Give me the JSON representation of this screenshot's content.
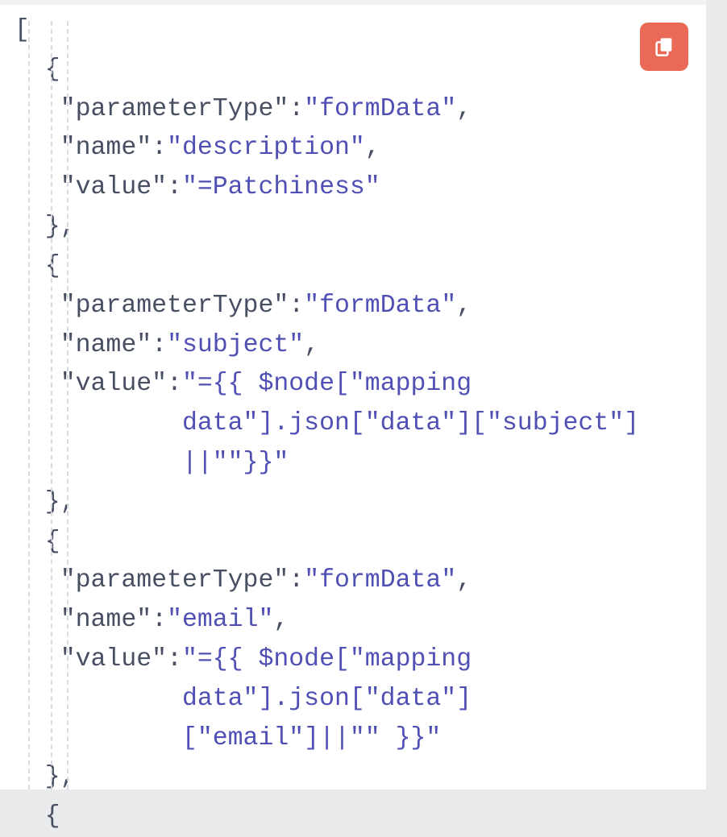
{
  "copy_button": {
    "label": "Copy",
    "icon_name": "copy-icon"
  },
  "code_tokens": [
    {
      "t": "[",
      "c": "pun"
    },
    {
      "t": "\n",
      "c": ""
    },
    {
      "t": "  {",
      "c": "pun"
    },
    {
      "t": "\n",
      "c": ""
    },
    {
      "t": "   ",
      "c": ""
    },
    {
      "t": "\"",
      "c": "pun"
    },
    {
      "t": "parameterType",
      "c": "k"
    },
    {
      "t": "\"",
      "c": "pun"
    },
    {
      "t": ":",
      "c": "pun"
    },
    {
      "t": "\"",
      "c": "vq"
    },
    {
      "t": "formData",
      "c": "v"
    },
    {
      "t": "\"",
      "c": "vq"
    },
    {
      "t": ",",
      "c": "pun"
    },
    {
      "t": "\n",
      "c": ""
    },
    {
      "t": "   ",
      "c": ""
    },
    {
      "t": "\"",
      "c": "pun"
    },
    {
      "t": "name",
      "c": "k"
    },
    {
      "t": "\"",
      "c": "pun"
    },
    {
      "t": ":",
      "c": "pun"
    },
    {
      "t": "\"",
      "c": "vq"
    },
    {
      "t": "description",
      "c": "v"
    },
    {
      "t": "\"",
      "c": "vq"
    },
    {
      "t": ",",
      "c": "pun"
    },
    {
      "t": "\n",
      "c": ""
    },
    {
      "t": "   ",
      "c": ""
    },
    {
      "t": "\"",
      "c": "pun"
    },
    {
      "t": "value",
      "c": "k"
    },
    {
      "t": "\"",
      "c": "pun"
    },
    {
      "t": ":",
      "c": "pun"
    },
    {
      "t": "\"",
      "c": "vq"
    },
    {
      "t": "=Patchiness",
      "c": "v"
    },
    {
      "t": "\"",
      "c": "vq"
    },
    {
      "t": "\n",
      "c": ""
    },
    {
      "t": "  },",
      "c": "pun"
    },
    {
      "t": "\n",
      "c": ""
    },
    {
      "t": "  {",
      "c": "pun"
    },
    {
      "t": "\n",
      "c": ""
    },
    {
      "t": "   ",
      "c": ""
    },
    {
      "t": "\"",
      "c": "pun"
    },
    {
      "t": "parameterType",
      "c": "k"
    },
    {
      "t": "\"",
      "c": "pun"
    },
    {
      "t": ":",
      "c": "pun"
    },
    {
      "t": "\"",
      "c": "vq"
    },
    {
      "t": "formData",
      "c": "v"
    },
    {
      "t": "\"",
      "c": "vq"
    },
    {
      "t": ",",
      "c": "pun"
    },
    {
      "t": "\n",
      "c": ""
    },
    {
      "t": "   ",
      "c": ""
    },
    {
      "t": "\"",
      "c": "pun"
    },
    {
      "t": "name",
      "c": "k"
    },
    {
      "t": "\"",
      "c": "pun"
    },
    {
      "t": ":",
      "c": "pun"
    },
    {
      "t": "\"",
      "c": "vq"
    },
    {
      "t": "subject",
      "c": "v"
    },
    {
      "t": "\"",
      "c": "vq"
    },
    {
      "t": ",",
      "c": "pun"
    },
    {
      "t": "\n",
      "c": ""
    },
    {
      "t": "   ",
      "c": ""
    },
    {
      "t": "\"",
      "c": "pun"
    },
    {
      "t": "value",
      "c": "k"
    },
    {
      "t": "\"",
      "c": "pun"
    },
    {
      "t": ":",
      "c": "pun"
    },
    {
      "t": "\"",
      "c": "vq"
    },
    {
      "t": "={{ $node[\"mapping ",
      "c": "v"
    },
    {
      "t": "\n",
      "c": ""
    },
    {
      "t": "           ",
      "c": ""
    },
    {
      "t": "data\"].json[\"data\"][\"subject\"]",
      "c": "v"
    },
    {
      "t": "\n",
      "c": ""
    },
    {
      "t": "           ",
      "c": ""
    },
    {
      "t": "||\"\"}}",
      "c": "v"
    },
    {
      "t": "\"",
      "c": "vq"
    },
    {
      "t": "\n",
      "c": ""
    },
    {
      "t": "  },",
      "c": "pun"
    },
    {
      "t": "\n",
      "c": ""
    },
    {
      "t": "  {",
      "c": "pun"
    },
    {
      "t": "\n",
      "c": ""
    },
    {
      "t": "   ",
      "c": ""
    },
    {
      "t": "\"",
      "c": "pun"
    },
    {
      "t": "parameterType",
      "c": "k"
    },
    {
      "t": "\"",
      "c": "pun"
    },
    {
      "t": ":",
      "c": "pun"
    },
    {
      "t": "\"",
      "c": "vq"
    },
    {
      "t": "formData",
      "c": "v"
    },
    {
      "t": "\"",
      "c": "vq"
    },
    {
      "t": ",",
      "c": "pun"
    },
    {
      "t": "\n",
      "c": ""
    },
    {
      "t": "   ",
      "c": ""
    },
    {
      "t": "\"",
      "c": "pun"
    },
    {
      "t": "name",
      "c": "k"
    },
    {
      "t": "\"",
      "c": "pun"
    },
    {
      "t": ":",
      "c": "pun"
    },
    {
      "t": "\"",
      "c": "vq"
    },
    {
      "t": "email",
      "c": "v"
    },
    {
      "t": "\"",
      "c": "vq"
    },
    {
      "t": ",",
      "c": "pun"
    },
    {
      "t": "\n",
      "c": ""
    },
    {
      "t": "   ",
      "c": ""
    },
    {
      "t": "\"",
      "c": "pun"
    },
    {
      "t": "value",
      "c": "k"
    },
    {
      "t": "\"",
      "c": "pun"
    },
    {
      "t": ":",
      "c": "pun"
    },
    {
      "t": "\"",
      "c": "vq"
    },
    {
      "t": "={{ $node[\"mapping ",
      "c": "v"
    },
    {
      "t": "\n",
      "c": ""
    },
    {
      "t": "           ",
      "c": ""
    },
    {
      "t": "data\"].json[\"data\"]",
      "c": "v"
    },
    {
      "t": "\n",
      "c": ""
    },
    {
      "t": "           ",
      "c": ""
    },
    {
      "t": "[\"email\"]||\"\" }}",
      "c": "v"
    },
    {
      "t": "\"",
      "c": "vq"
    },
    {
      "t": "\n",
      "c": ""
    },
    {
      "t": "  },",
      "c": "pun"
    },
    {
      "t": "\n",
      "c": ""
    },
    {
      "t": "  {",
      "c": "pun"
    }
  ],
  "parameters": [
    {
      "parameterType": "formData",
      "name": "description",
      "value": "=Patchiness"
    },
    {
      "parameterType": "formData",
      "name": "subject",
      "value": "={{ $node[\"mapping data\"].json[\"data\"][\"subject\"]||\"\"}}"
    },
    {
      "parameterType": "formData",
      "name": "email",
      "value": "={{ $node[\"mapping data\"].json[\"data\"][\"email\"]||\"\" }}"
    }
  ]
}
